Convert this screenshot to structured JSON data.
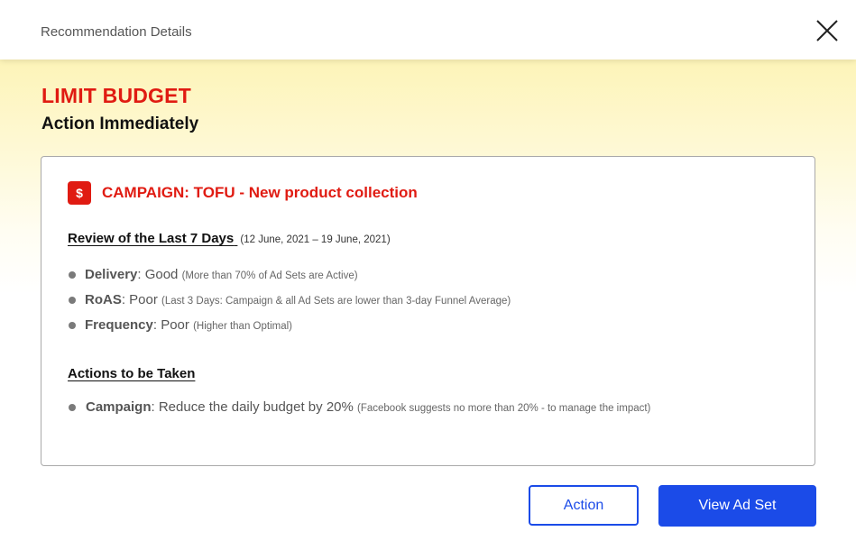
{
  "header": {
    "title": "Recommendation Details",
    "close_icon": "close-icon"
  },
  "recommendation": {
    "type": "LIMIT BUDGET",
    "urgency": "Action Immediately"
  },
  "card": {
    "campaign_icon": "dollar-icon",
    "campaign_icon_glyph": "$",
    "campaign_name": "CAMPAIGN: TOFU - New product collection",
    "review": {
      "title": "Review of the Last 7 Days",
      "date_range": "(12 June, 2021 – 19 June, 2021)",
      "items": [
        {
          "key": "Delivery",
          "value": ": Good",
          "note": "(More than 70% of Ad Sets are Active)"
        },
        {
          "key": "RoAS",
          "value": ": Poor",
          "note": "(Last 3 Days: Campaign & all Ad Sets are lower than 3-day Funnel Average)"
        },
        {
          "key": "Frequency",
          "value": ": Poor",
          "note": "(Higher than Optimal)"
        }
      ]
    },
    "actions": {
      "title": "Actions to be Taken",
      "items": [
        {
          "key": "Campaign",
          "value": ": Reduce the daily budget by 20%",
          "note": "(Facebook suggests no more than 20% - to manage the impact)"
        }
      ]
    }
  },
  "buttons": {
    "action_label": "Action",
    "view_label": "View Ad Set"
  },
  "colors": {
    "accent_red": "#e01b12",
    "primary_blue": "#1b4be8",
    "gradient_top": "#fdf4b8"
  }
}
